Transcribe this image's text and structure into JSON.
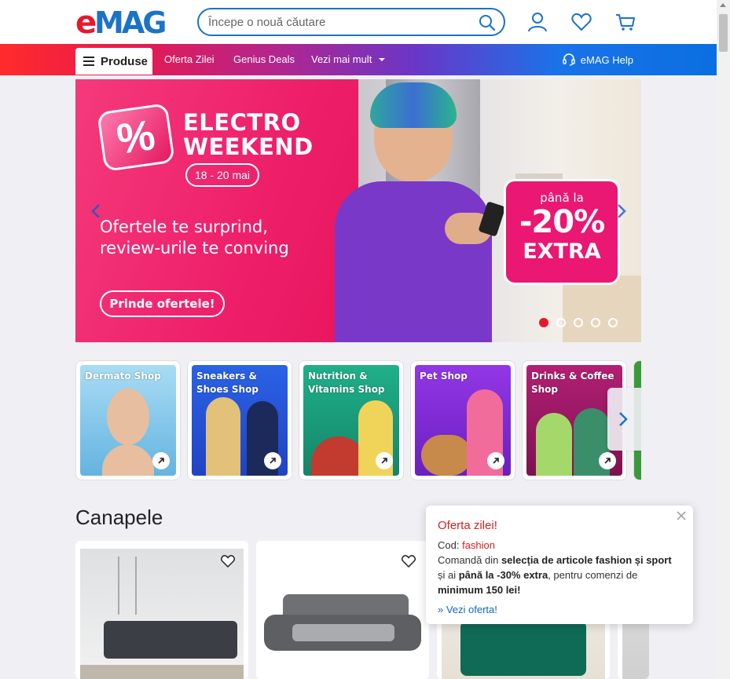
{
  "header": {
    "logo_text": "eMAG",
    "search_placeholder": "Începe o nouă căutare",
    "icons": [
      "search-icon",
      "user-icon",
      "heart-icon",
      "cart-icon"
    ]
  },
  "navbar": {
    "produse_label": "Produse",
    "links": [
      "Oferta Zilei",
      "Genius Deals",
      "Vezi mai mult"
    ],
    "help_label": "eMAG Help"
  },
  "banner": {
    "title_line1": "ELECTRO",
    "title_line2": "WEEKEND",
    "badge_symbol": "%",
    "date": "18 - 20 mai",
    "subtitle_line1": "Ofertele te surprind,",
    "subtitle_line2": "review-urile te conving",
    "cta": "Prinde ofertele!",
    "promo_line1": "până la",
    "promo_line2": "-20%",
    "promo_line3": "EXTRA",
    "slides_count": 5,
    "active_slide": 1
  },
  "shops": [
    {
      "label": "Dermato Shop",
      "bg": "#7cc6ea"
    },
    {
      "label": "Sneakers & Shoes Shop",
      "bg": "#2b58d8"
    },
    {
      "label": "Nutrition & Vitamins Shop",
      "bg": "#1aa179"
    },
    {
      "label": "Pet Shop",
      "bg": "#8a2be2"
    },
    {
      "label": "Drinks & Coffee Shop",
      "bg": "#b01c6b"
    }
  ],
  "section": {
    "title": "Canapele"
  },
  "popup": {
    "title": "Oferta zilei!",
    "code_label": "Cod:",
    "code_value": "fashion",
    "text_1": "Comandă din ",
    "text_bold_1": "selecția de articole fashion și sport",
    "text_2": " și ai ",
    "text_bold_2": "până la -30% extra",
    "text_3": ", pentru comenzi de ",
    "text_bold_3": "minimum 150 lei!",
    "link": "» Vezi oferta!"
  },
  "colors": {
    "brand_red": "#e7182d",
    "brand_blue": "#1a73c8",
    "banner_pink": "#ea1773"
  }
}
